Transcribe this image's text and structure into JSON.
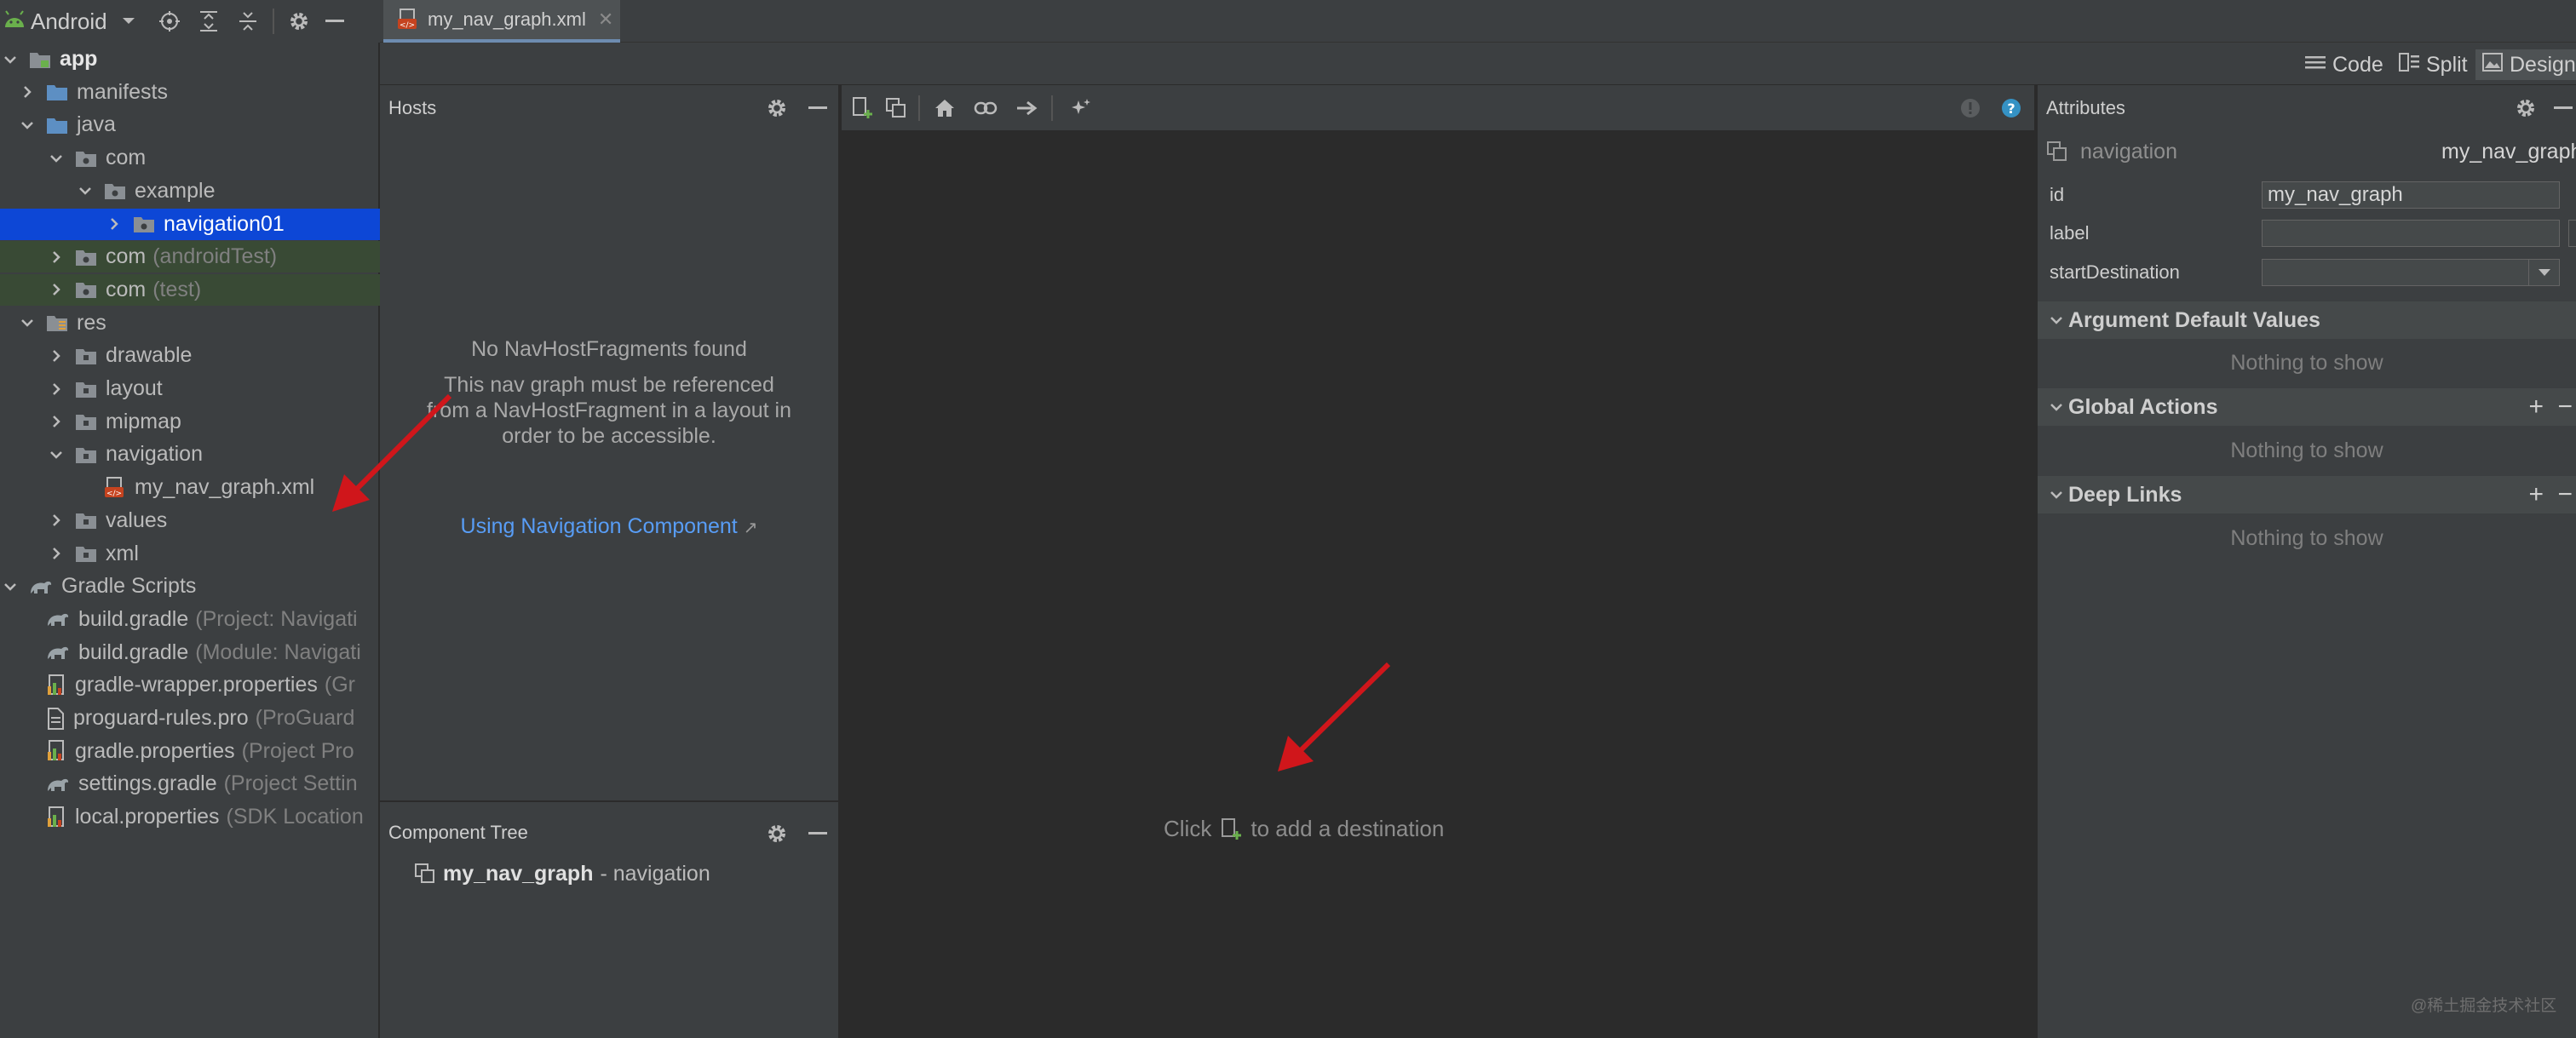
{
  "project": {
    "view_label": "Android",
    "tree": [
      {
        "label": "app",
        "hint": "",
        "depth": 0,
        "kind": "module",
        "chevron": "down"
      },
      {
        "label": "manifests",
        "hint": "",
        "depth": 1,
        "kind": "folder-blue",
        "chevron": "right"
      },
      {
        "label": "java",
        "hint": "",
        "depth": 1,
        "kind": "folder-blue",
        "chevron": "down"
      },
      {
        "label": "com",
        "hint": "",
        "depth": 2,
        "kind": "package",
        "chevron": "down"
      },
      {
        "label": "example",
        "hint": "",
        "depth": 3,
        "kind": "package",
        "chevron": "down"
      },
      {
        "label": "navigation01",
        "hint": "",
        "depth": 4,
        "kind": "package",
        "chevron": "right"
      },
      {
        "label": "com",
        "hint": "(androidTest)",
        "depth": 2,
        "kind": "package",
        "chevron": "right"
      },
      {
        "label": "com",
        "hint": "(test)",
        "depth": 2,
        "kind": "package",
        "chevron": "right"
      },
      {
        "label": "res",
        "hint": "",
        "depth": 1,
        "kind": "res",
        "chevron": "down"
      },
      {
        "label": "drawable",
        "hint": "",
        "depth": 2,
        "kind": "folder",
        "chevron": "right"
      },
      {
        "label": "layout",
        "hint": "",
        "depth": 2,
        "kind": "folder",
        "chevron": "right"
      },
      {
        "label": "mipmap",
        "hint": "",
        "depth": 2,
        "kind": "folder",
        "chevron": "right"
      },
      {
        "label": "navigation",
        "hint": "",
        "depth": 2,
        "kind": "folder",
        "chevron": "down"
      },
      {
        "label": "my_nav_graph.xml",
        "hint": "",
        "depth": 3,
        "kind": "xml",
        "chevron": ""
      },
      {
        "label": "values",
        "hint": "",
        "depth": 2,
        "kind": "folder",
        "chevron": "right"
      },
      {
        "label": "xml",
        "hint": "",
        "depth": 2,
        "kind": "folder",
        "chevron": "right"
      },
      {
        "label": "Gradle Scripts",
        "hint": "",
        "depth": 0,
        "kind": "gradle",
        "chevron": "down"
      },
      {
        "label": "build.gradle",
        "hint": "(Project: Navigati",
        "depth": 1,
        "kind": "gradle",
        "chevron": ""
      },
      {
        "label": "build.gradle",
        "hint": "(Module: Navigati",
        "depth": 1,
        "kind": "gradle",
        "chevron": ""
      },
      {
        "label": "gradle-wrapper.properties",
        "hint": "(Gr",
        "depth": 1,
        "kind": "props",
        "chevron": ""
      },
      {
        "label": "proguard-rules.pro",
        "hint": "(ProGuard",
        "depth": 1,
        "kind": "file",
        "chevron": ""
      },
      {
        "label": "gradle.properties",
        "hint": "(Project Pro",
        "depth": 1,
        "kind": "props",
        "chevron": ""
      },
      {
        "label": "settings.gradle",
        "hint": "(Project Settin",
        "depth": 1,
        "kind": "gradle",
        "chevron": ""
      },
      {
        "label": "local.properties",
        "hint": "(SDK Location",
        "depth": 1,
        "kind": "props",
        "chevron": ""
      }
    ]
  },
  "editor": {
    "tab_label": "my_nav_graph.xml",
    "modes": {
      "code": "Code",
      "split": "Split",
      "design": "Design"
    }
  },
  "hosts": {
    "title": "Hosts",
    "empty_title": "No NavHostFragments found",
    "empty_body": "This nav graph must be referenced from a NavHostFragment in a layout in order to be accessible.",
    "link": "Using Navigation Component",
    "link_arrow": "↗"
  },
  "component_tree": {
    "title": "Component Tree",
    "root_name": "my_nav_graph",
    "root_type": "- navigation"
  },
  "canvas": {
    "hint_before": "Click",
    "hint_after": "to add a destination"
  },
  "attributes": {
    "title": "Attributes",
    "element_type": "navigation",
    "element_name": "my_nav_graph",
    "fields": {
      "id_label": "id",
      "id_value": "my_nav_graph",
      "label_label": "label",
      "label_value": "",
      "start_label": "startDestination",
      "start_value": ""
    },
    "sections": {
      "args_title": "Argument Default Values",
      "args_empty": "Nothing to show",
      "actions_title": "Global Actions",
      "actions_empty": "Nothing to show",
      "links_title": "Deep Links",
      "links_empty": "Nothing to show"
    }
  },
  "watermark": "@稀土掘金技术社区",
  "colors": {
    "selection": "#0d47d6",
    "link": "#589df6",
    "annotation_arrow": "#d0161b"
  }
}
